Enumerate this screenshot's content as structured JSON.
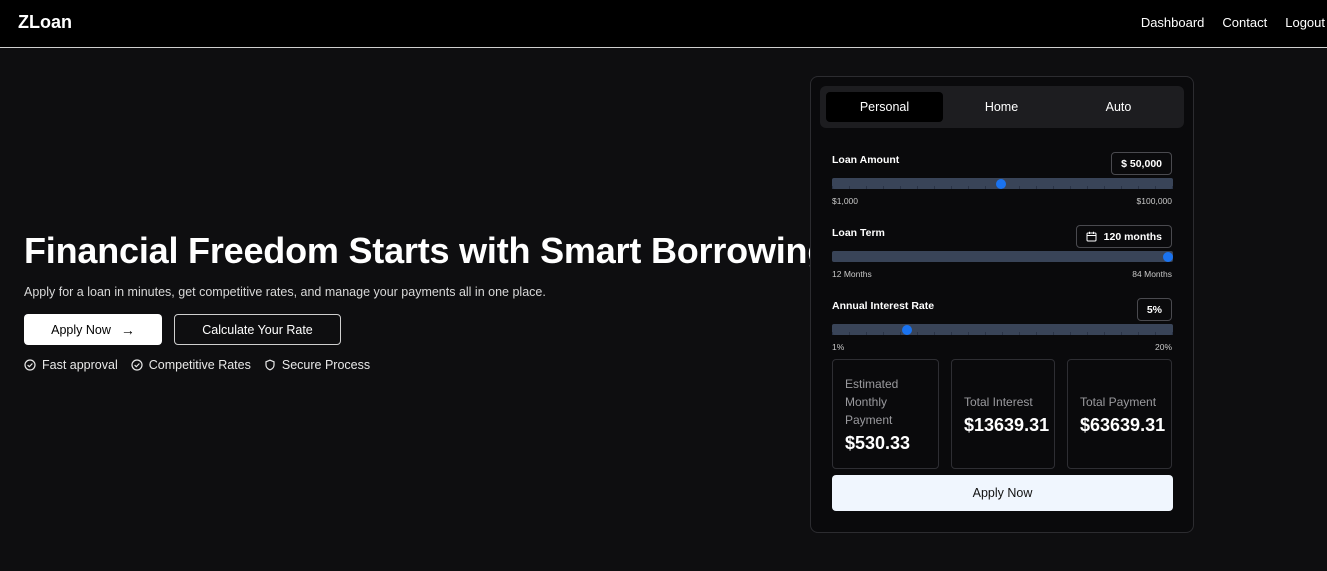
{
  "header": {
    "brand": "ZLoan",
    "nav": [
      "Dashboard",
      "Contact",
      "Logout"
    ]
  },
  "hero": {
    "title": "Financial Freedom Starts with Smart Borrowing",
    "subtitle": "Apply for a loan in minutes, get competitive rates, and manage your payments all in one place.",
    "apply_label": "Apply Now",
    "calc_label": "Calculate Your Rate",
    "features": [
      {
        "label": "Fast approval",
        "icon": "check-circle-icon"
      },
      {
        "label": "Competitive Rates",
        "icon": "check-circle-icon"
      },
      {
        "label": "Secure Process",
        "icon": "shield-icon"
      }
    ]
  },
  "calculator": {
    "tabs": [
      "Personal",
      "Home",
      "Auto"
    ],
    "active_tab": "Personal",
    "amount": {
      "label": "Loan Amount",
      "value": "$ 50,000",
      "min": "$1,000",
      "max": "$100,000",
      "fraction": 0.495
    },
    "term": {
      "label": "Loan Term",
      "value": "120 months",
      "min": "12 Months",
      "max": "84 Months",
      "fraction": 1.0
    },
    "rate": {
      "label": "Annual Interest Rate",
      "value": "5%",
      "min": "1%",
      "max": "20%",
      "fraction": 0.22
    },
    "results": {
      "monthly_label": "Estimated Monthly Payment",
      "monthly_value": "$530.33",
      "interest_label": "Total Interest",
      "interest_value": "$13639.31",
      "total_label": "Total Payment",
      "total_value": "$63639.31"
    },
    "apply_label": "Apply Now"
  },
  "colors": {
    "background": "#0e0e10",
    "accent": "#1a73f0",
    "track": "#394458"
  }
}
